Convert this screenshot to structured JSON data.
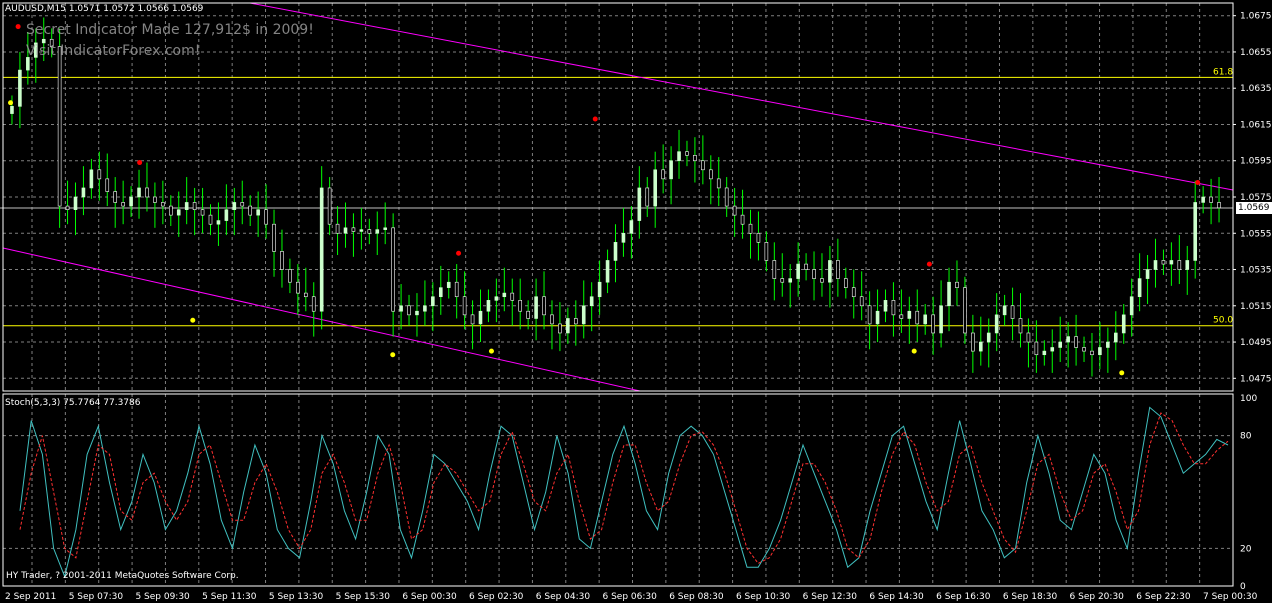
{
  "window": {
    "symbol_line": "AUDUSD,M15  1.0571 1.0572 1.0566 1.0569",
    "promo_line_1": "Secret Indicator Made 127,912$ in 2009!",
    "promo_line_2": "Visit IndicatorForex.com!",
    "stoch_line": "Stoch(5,3,3) 75.7764 77.3786",
    "copyright": "HY Trader, ? 2001-2011 MetaQuotes Software Corp.",
    "current_price": "1.0569"
  },
  "colors": {
    "background": "#000000",
    "bull_candle": "#ccffcc",
    "bear_candle": "#ffffff",
    "wick": "#00ff00",
    "grid": "#7f7f7f",
    "channel": "#ff00ff",
    "fib": "#ffff00",
    "dot_high": "#ff0000",
    "dot_low": "#ffff00",
    "stoch_main": "#40c0c0",
    "stoch_signal": "#ff3030"
  },
  "chart_data": [
    {
      "type": "candlestick",
      "title": "AUDUSD,M15",
      "y_ticks": [
        "1.0675",
        "1.0655",
        "1.0635",
        "1.0615",
        "1.0595",
        "1.0575",
        "1.0555",
        "1.0535",
        "1.0515",
        "1.0495",
        "1.0475"
      ],
      "x_ticks": [
        "2 Sep 2011",
        "5 Sep 07:30",
        "5 Sep 09:30",
        "5 Sep 11:30",
        "5 Sep 13:30",
        "5 Sep 15:30",
        "6 Sep 00:30",
        "6 Sep 02:30",
        "6 Sep 04:30",
        "6 Sep 06:30",
        "6 Sep 08:30",
        "6 Sep 10:30",
        "6 Sep 12:30",
        "6 Sep 14:30",
        "6 Sep 16:30",
        "6 Sep 18:30",
        "6 Sep 20:30",
        "6 Sep 22:30",
        "7 Sep 00:30"
      ],
      "ylim": [
        1.0468,
        1.0682
      ],
      "fib_levels": [
        {
          "label": "61.8",
          "price": 1.0641
        },
        {
          "label": "50.0",
          "price": 1.0504
        }
      ],
      "current_price": 1.0569,
      "close_series": [
        1.0625,
        1.0645,
        1.0652,
        1.066,
        1.0662,
        1.0658,
        1.057,
        1.0568,
        1.0575,
        1.058,
        1.059,
        1.0585,
        1.0578,
        1.0572,
        1.057,
        1.0575,
        1.058,
        1.0575,
        1.0572,
        1.057,
        1.0565,
        1.0568,
        1.0572,
        1.0568,
        1.0565,
        1.056,
        1.0562,
        1.0568,
        1.0572,
        1.057,
        1.0565,
        1.0568,
        1.056,
        1.0545,
        1.0535,
        1.0528,
        1.0522,
        1.052,
        1.0512,
        1.058,
        1.056,
        1.0555,
        1.0558,
        1.0556,
        1.0557,
        1.0555,
        1.0557,
        1.0558,
        1.0512,
        1.0515,
        1.051,
        1.0512,
        1.0515,
        1.052,
        1.0525,
        1.0528,
        1.052,
        1.051,
        1.0505,
        1.0512,
        1.0518,
        1.052,
        1.0522,
        1.0518,
        1.0512,
        1.0508,
        1.052,
        1.051,
        1.0505,
        1.05,
        1.0508,
        1.0505,
        1.0515,
        1.052,
        1.0528,
        1.054,
        1.055,
        1.0555,
        1.0562,
        1.058,
        1.057,
        1.059,
        1.0585,
        1.0595,
        1.06,
        1.0598,
        1.0595,
        1.059,
        1.0585,
        1.058,
        1.057,
        1.0565,
        1.056,
        1.0555,
        1.055,
        1.054,
        1.053,
        1.0528,
        1.053,
        1.0538,
        1.0535,
        1.053,
        1.0528,
        1.054,
        1.053,
        1.0525,
        1.052,
        1.0515,
        1.0505,
        1.0512,
        1.0518,
        1.051,
        1.0508,
        1.0512,
        1.0505,
        1.051,
        1.05,
        1.0515,
        1.0528,
        1.0525,
        1.05,
        1.049,
        1.0495,
        1.05,
        1.051,
        1.0515,
        1.0508,
        1.05,
        1.0495,
        1.0488,
        1.049,
        1.0492,
        1.0495,
        1.0498,
        1.0492,
        1.049,
        1.0488,
        1.0492,
        1.0495,
        1.05,
        1.051,
        1.052,
        1.053,
        1.0535,
        1.054,
        1.0538,
        1.054,
        1.0535,
        1.054,
        1.0572,
        1.0575,
        1.0572,
        1.0569
      ],
      "high_dots": [
        [
          4,
          1.0669
        ],
        [
          52,
          1.0594
        ],
        [
          178,
          1.0544
        ],
        [
          232,
          1.0618
        ],
        [
          364,
          1.0538
        ],
        [
          470,
          1.0583
        ]
      ],
      "low_dots": [
        [
          1,
          1.0627
        ],
        [
          73,
          1.0507
        ],
        [
          191,
          1.049
        ],
        [
          152,
          1.0488
        ],
        [
          358,
          1.049
        ],
        [
          440,
          1.0478
        ]
      ]
    },
    {
      "type": "line",
      "title": "Stoch(5,3,3)",
      "y_ticks": [
        "100",
        "80",
        "20",
        "0"
      ],
      "ylim": [
        0,
        100
      ],
      "series": [
        {
          "name": "main",
          "values": [
            40,
            88,
            70,
            20,
            5,
            30,
            70,
            85,
            55,
            30,
            45,
            70,
            55,
            30,
            40,
            60,
            85,
            65,
            35,
            20,
            50,
            75,
            60,
            30,
            20,
            15,
            45,
            80,
            65,
            40,
            25,
            50,
            80,
            70,
            30,
            15,
            40,
            70,
            65,
            55,
            45,
            30,
            60,
            85,
            80,
            55,
            30,
            50,
            80,
            60,
            25,
            20,
            45,
            70,
            85,
            65,
            40,
            30,
            60,
            80,
            85,
            80,
            70,
            50,
            30,
            10,
            10,
            20,
            35,
            55,
            75,
            60,
            45,
            30,
            10,
            15,
            40,
            60,
            80,
            85,
            65,
            45,
            30,
            60,
            88,
            65,
            40,
            30,
            15,
            20,
            55,
            80,
            60,
            35,
            30,
            50,
            70,
            60,
            35,
            20,
            60,
            95,
            90,
            75,
            60,
            65,
            70,
            78,
            75
          ]
        },
        {
          "name": "signal",
          "values": [
            30,
            60,
            80,
            50,
            20,
            15,
            45,
            75,
            70,
            40,
            35,
            55,
            60,
            45,
            35,
            45,
            70,
            75,
            55,
            35,
            35,
            55,
            65,
            50,
            30,
            20,
            30,
            60,
            70,
            55,
            35,
            35,
            60,
            75,
            55,
            25,
            30,
            55,
            65,
            60,
            50,
            40,
            45,
            70,
            82,
            65,
            45,
            40,
            60,
            70,
            45,
            25,
            30,
            55,
            75,
            75,
            55,
            40,
            45,
            65,
            80,
            82,
            75,
            60,
            40,
            20,
            12,
            15,
            25,
            45,
            65,
            65,
            55,
            40,
            20,
            15,
            25,
            50,
            70,
            82,
            75,
            55,
            40,
            45,
            70,
            75,
            55,
            40,
            25,
            18,
            40,
            65,
            70,
            50,
            35,
            40,
            60,
            65,
            50,
            30,
            40,
            75,
            92,
            88,
            75,
            65,
            65,
            72,
            77
          ]
        }
      ]
    }
  ]
}
